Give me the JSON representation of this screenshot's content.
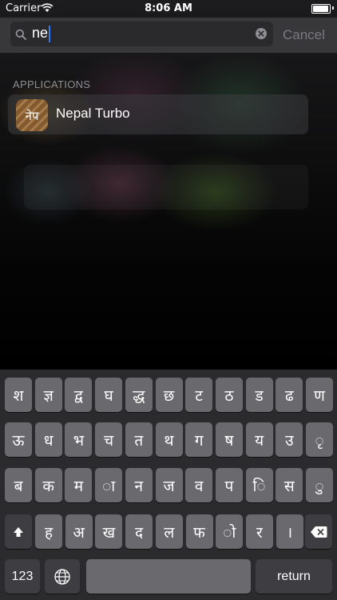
{
  "status": {
    "carrier": "Carrier",
    "time": "8:06 AM"
  },
  "search": {
    "query": "ne",
    "cancel_label": "Cancel"
  },
  "results": {
    "section_title": "APPLICATIONS",
    "apps": [
      {
        "name": "Nepal Turbo",
        "icon_text": "नेप"
      }
    ]
  },
  "keyboard": {
    "rows": [
      [
        "श",
        "ज्ञ",
        "द्व",
        "घ",
        "द्ध",
        "छ",
        "ट",
        "ठ",
        "ड",
        "ढ",
        "ण"
      ],
      [
        "ऊ",
        "ध",
        "भ",
        "च",
        "त",
        "थ",
        "ग",
        "ष",
        "य",
        "उ",
        "ृ"
      ],
      [
        "ब",
        "क",
        "म",
        "ा",
        "न",
        "ज",
        "व",
        "प",
        "ि",
        "स",
        "ु"
      ],
      [
        "ह",
        "अ",
        "ख",
        "द",
        "ल",
        "फ",
        "ो",
        "र",
        "।"
      ]
    ],
    "numbers_label": "123",
    "return_label": "return"
  },
  "colors": {
    "caret": "#2f7cf6",
    "key": "#6a6a6e",
    "key_dark": "#3e3e42"
  }
}
